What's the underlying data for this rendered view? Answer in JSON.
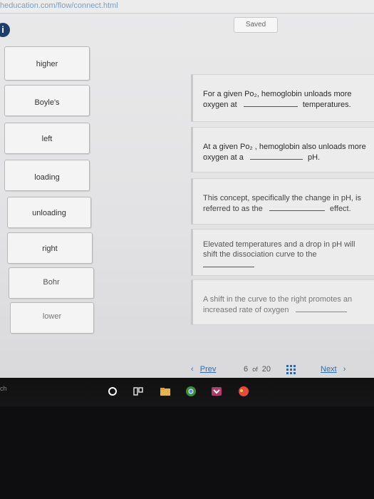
{
  "browser": {
    "url": "heducation.com/flow/connect.html"
  },
  "header": {
    "saved_label": "Saved",
    "info_icon": "i"
  },
  "word_bank": [
    {
      "label": "higher"
    },
    {
      "label": "Boyle's"
    },
    {
      "label": "left"
    },
    {
      "label": "loading"
    },
    {
      "label": "unloading"
    },
    {
      "label": "right"
    },
    {
      "label": "Bohr"
    },
    {
      "label": "lower"
    }
  ],
  "prompts": [
    {
      "line1": "For a given Po₂, hemoglobin unloads more",
      "line2a": "oxygen at",
      "line2b": "temperatures."
    },
    {
      "line1": "At a given Po₂ , hemoglobin also unloads more",
      "line2a": "oxygen at a",
      "line2b": "pH."
    },
    {
      "line1": "This concept, specifically the change in pH, is",
      "line2a": "referred to as the",
      "line2b": "effect."
    },
    {
      "line1": "Elevated temperatures and a drop in pH will",
      "line2a": "shift the dissociation curve to the",
      "line2b": ""
    },
    {
      "line1": "A shift in the curve to the right promotes an",
      "line2a": "increased rate of oxygen",
      "line2b": ""
    }
  ],
  "pager": {
    "prev_label": "Prev",
    "current": "6",
    "of_label": "of",
    "total": "20",
    "next_label": "Next"
  },
  "taskbar": {
    "search_stub": "ch"
  },
  "colors": {
    "accent": "#2f6fb0",
    "info_badge": "#1d3f6e"
  }
}
